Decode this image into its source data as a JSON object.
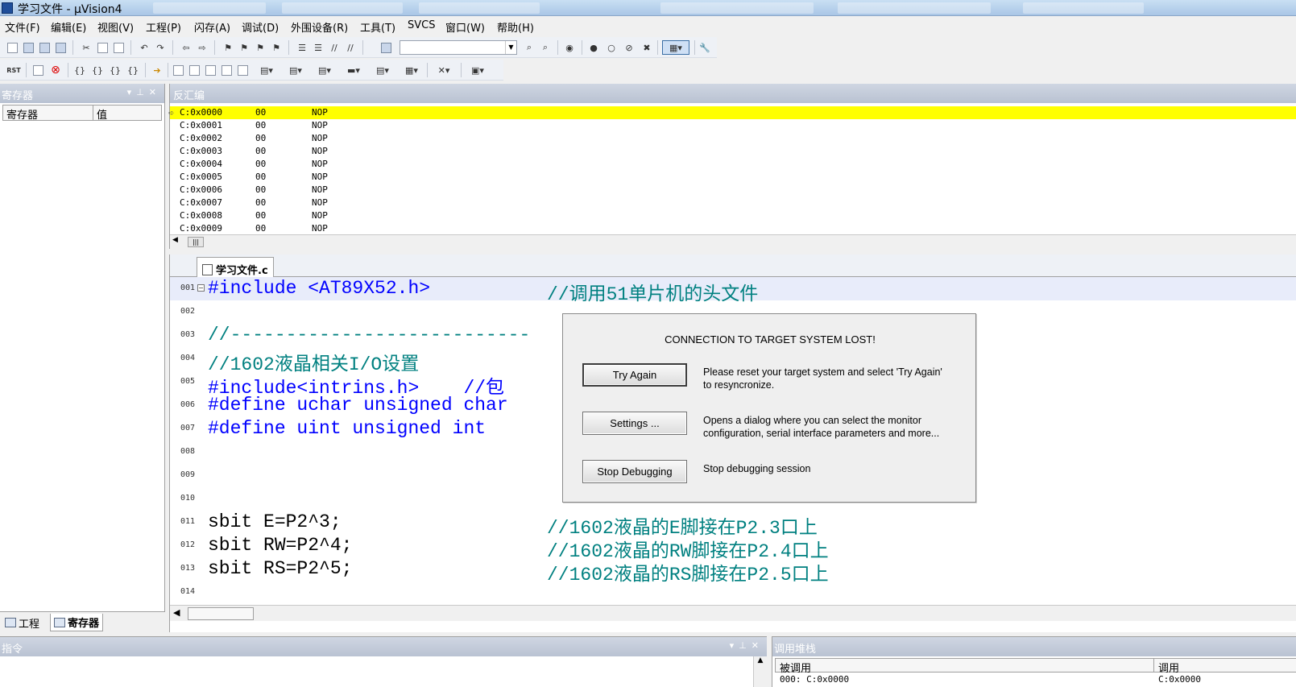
{
  "window": {
    "title": "学习文件  - µVision4"
  },
  "menu": [
    "文件(F)",
    "编辑(E)",
    "视图(V)",
    "工程(P)",
    "闪存(A)",
    "调试(D)",
    "外围设备(R)",
    "工具(T)",
    "SVCS",
    "窗口(W)",
    "帮助(H)"
  ],
  "toolbar2": {
    "rst_label": "RST"
  },
  "registers_panel": {
    "title": "寄存器",
    "columns": [
      "寄存器",
      "值"
    ],
    "tabs": [
      "工程",
      "寄存器"
    ]
  },
  "disassembly": {
    "title": "反汇编",
    "rows": [
      {
        "addr": "C:0x0000",
        "opcode": "00",
        "instr": "NOP"
      },
      {
        "addr": "C:0x0001",
        "opcode": "00",
        "instr": "NOP"
      },
      {
        "addr": "C:0x0002",
        "opcode": "00",
        "instr": "NOP"
      },
      {
        "addr": "C:0x0003",
        "opcode": "00",
        "instr": "NOP"
      },
      {
        "addr": "C:0x0004",
        "opcode": "00",
        "instr": "NOP"
      },
      {
        "addr": "C:0x0005",
        "opcode": "00",
        "instr": "NOP"
      },
      {
        "addr": "C:0x0006",
        "opcode": "00",
        "instr": "NOP"
      },
      {
        "addr": "C:0x0007",
        "opcode": "00",
        "instr": "NOP"
      },
      {
        "addr": "C:0x0008",
        "opcode": "00",
        "instr": "NOP"
      },
      {
        "addr": "C:0x0009",
        "opcode": "00",
        "instr": "NOP"
      }
    ]
  },
  "editor": {
    "tab": "学习文件.c",
    "lines": [
      {
        "num": "001",
        "code": "#include <AT89X52.h>",
        "comment": "//调用51单片机的头文件"
      },
      {
        "num": "002",
        "code": "",
        "comment": ""
      },
      {
        "num": "003",
        "code": "//---------------------------",
        "comment": ""
      },
      {
        "num": "004",
        "code": "//1602液晶相关I/O设置",
        "comment": ""
      },
      {
        "num": "005",
        "code": "#include<intrins.h>    //包",
        "comment": ""
      },
      {
        "num": "006",
        "code": "#define uchar unsigned char",
        "comment": ""
      },
      {
        "num": "007",
        "code": "#define uint unsigned int",
        "comment": ""
      },
      {
        "num": "008",
        "code": "",
        "comment": ""
      },
      {
        "num": "009",
        "code": "",
        "comment": ""
      },
      {
        "num": "010",
        "code": "",
        "comment": ""
      },
      {
        "num": "011",
        "code": "sbit E=P2^3;",
        "comment": "//1602液晶的E脚接在P2.3口上"
      },
      {
        "num": "012",
        "code": "sbit RW=P2^4;",
        "comment": "//1602液晶的RW脚接在P2.4口上"
      },
      {
        "num": "013",
        "code": "sbit RS=P2^5;",
        "comment": "//1602液晶的RS脚接在P2.5口上"
      },
      {
        "num": "014",
        "code": "",
        "comment": ""
      }
    ]
  },
  "command_panel": {
    "title": "指令"
  },
  "callstack": {
    "title": "调用堆栈",
    "columns": [
      "被调用",
      "调用"
    ],
    "row": {
      "callee": "000: C:0x0000",
      "caller": "C:0x0000"
    }
  },
  "dialog": {
    "title": "CONNECTION TO TARGET SYSTEM LOST!",
    "try_again": "Try Again",
    "try_again_desc_1": "Please reset your target system and select 'Try Again'",
    "try_again_desc_2": "to resyncronize.",
    "settings": "Settings ...",
    "settings_desc_1": "Opens a dialog where you can select the monitor",
    "settings_desc_2": "configuration, serial interface parameters and more...",
    "stop": "Stop Debugging",
    "stop_desc": "Stop debugging session"
  },
  "colors": {
    "current_line": "#ffff00",
    "comment": "#008080",
    "preprocessor": "#0000ff",
    "panel_header": "#b9c2d2"
  }
}
